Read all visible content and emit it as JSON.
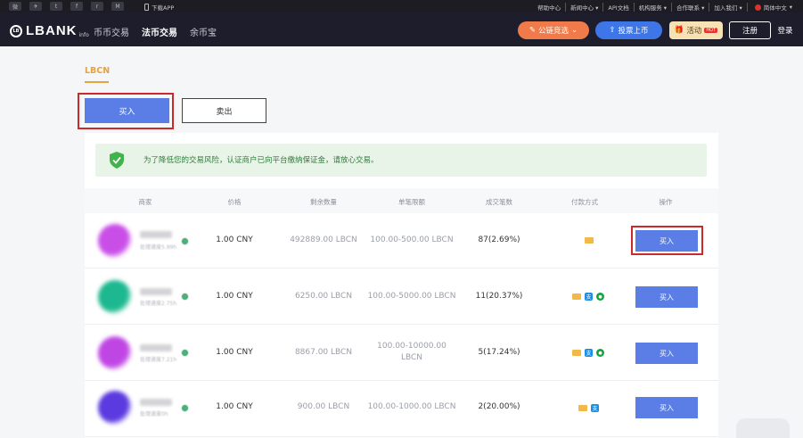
{
  "topbar": {
    "social_icons": [
      "weibo-icon",
      "telegram-icon",
      "twitter-icon",
      "facebook-icon",
      "reddit-icon",
      "medium-icon"
    ],
    "download_label": "下载APP",
    "links": [
      "帮助中心",
      "新闻中心",
      "API文档",
      "机构服务",
      "合作联系",
      "加入我们"
    ],
    "language": "简体中文"
  },
  "header": {
    "logo": "LBANK",
    "logo_suffix": "info",
    "nav": [
      "币币交易",
      "法币交易",
      "余币宝"
    ],
    "vote_button": "公链竞选",
    "list_button": "投票上币",
    "event_button": "活动",
    "event_badge": "HOT",
    "register_button": "注册",
    "login_button": "登录"
  },
  "page": {
    "coin_tab": "LBCN",
    "buy_tab": "买入",
    "sell_tab": "卖出",
    "notice": "为了降低您的交易风险，认证商户已向平台缴纳保证金，请放心交易。"
  },
  "table": {
    "headers": [
      "商家",
      "价格",
      "剩余数量",
      "单笔限额",
      "成交笔数",
      "付款方式",
      "操作"
    ],
    "rows": [
      {
        "status": "处理速度5.99h",
        "price": "1.00 CNY",
        "remaining": "492889.00 LBCN",
        "limit": "100.00-500.00 LBCN",
        "trades": "87(2.69%)",
        "payments": [
          "bank"
        ],
        "action": "买入",
        "avatar_color": "#c94ee8"
      },
      {
        "status": "处理速度2.75h",
        "price": "1.00 CNY",
        "remaining": "6250.00 LBCN",
        "limit": "100.00-5000.00 LBCN",
        "trades": "11(20.37%)",
        "payments": [
          "bank",
          "alipay",
          "wechat"
        ],
        "action": "买入",
        "avatar_color": "#1db88f"
      },
      {
        "status": "处理速度7.21h",
        "price": "1.00 CNY",
        "remaining": "8867.00 LBCN",
        "limit_line1": "100.00-10000.00",
        "limit_line2": "LBCN",
        "trades": "5(17.24%)",
        "payments": [
          "bank",
          "alipay",
          "wechat"
        ],
        "action": "买入",
        "avatar_color": "#c046e4"
      },
      {
        "status": "处理速度0h",
        "price": "1.00 CNY",
        "remaining": "900.00 LBCN",
        "limit": "100.00-1000.00 LBCN",
        "trades": "2(20.00%)",
        "payments": [
          "bank",
          "alipay"
        ],
        "action": "买入",
        "avatar_color": "#5b3ae0"
      }
    ]
  },
  "colors": {
    "accent": "#5a7de6",
    "coin_tab": "#e6a23c",
    "header_bg": "#1d1d2b",
    "notice_bg": "#e9f4e8",
    "highlight": "#cc2a2a"
  }
}
